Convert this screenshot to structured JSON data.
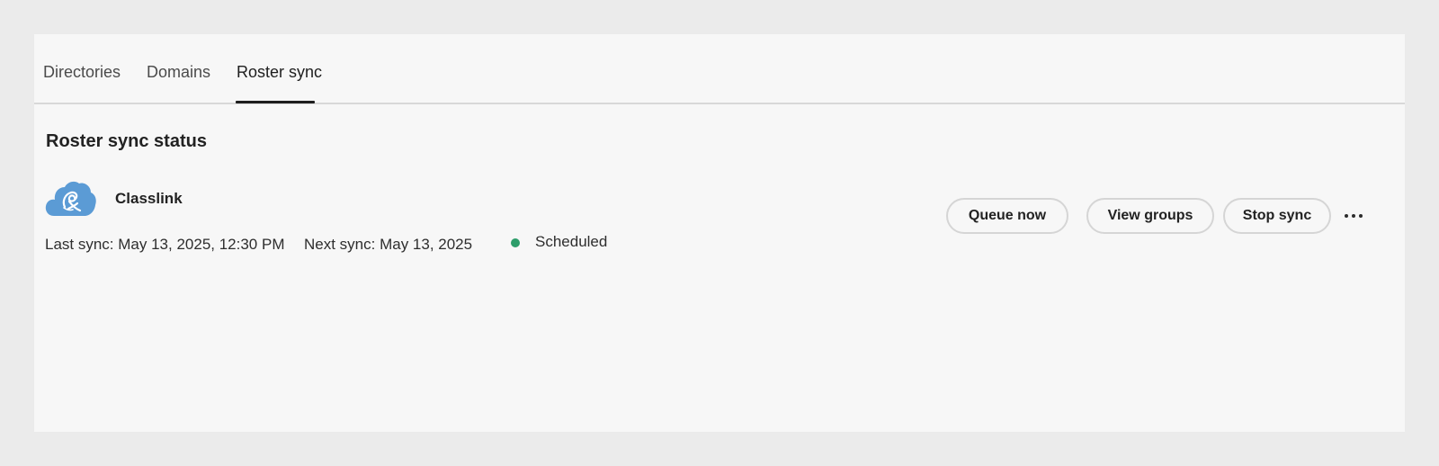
{
  "tabs": [
    {
      "label": "Directories",
      "active": false
    },
    {
      "label": "Domains",
      "active": false
    },
    {
      "label": "Roster sync",
      "active": true
    }
  ],
  "section": {
    "title": "Roster sync status"
  },
  "provider": {
    "name": "Classlink",
    "logo_icon": "classlink-cloud-logo",
    "logo_color": "#5b9bd5",
    "last_sync": "Last sync: May 13, 2025, 12:30 PM",
    "next_sync": "Next sync: May 13, 2025",
    "status": {
      "label": "Scheduled",
      "color": "#2d9d6a"
    }
  },
  "actions": {
    "queue_now": "Queue now",
    "view_groups": "View groups",
    "stop_sync": "Stop sync",
    "more_icon": "more-horizontal-icon"
  },
  "colors": {
    "page_background": "#ebebeb",
    "panel_background": "#f7f7f7",
    "tab_divider": "#d8d8d8",
    "active_tab_indicator": "#1e1e1e"
  }
}
